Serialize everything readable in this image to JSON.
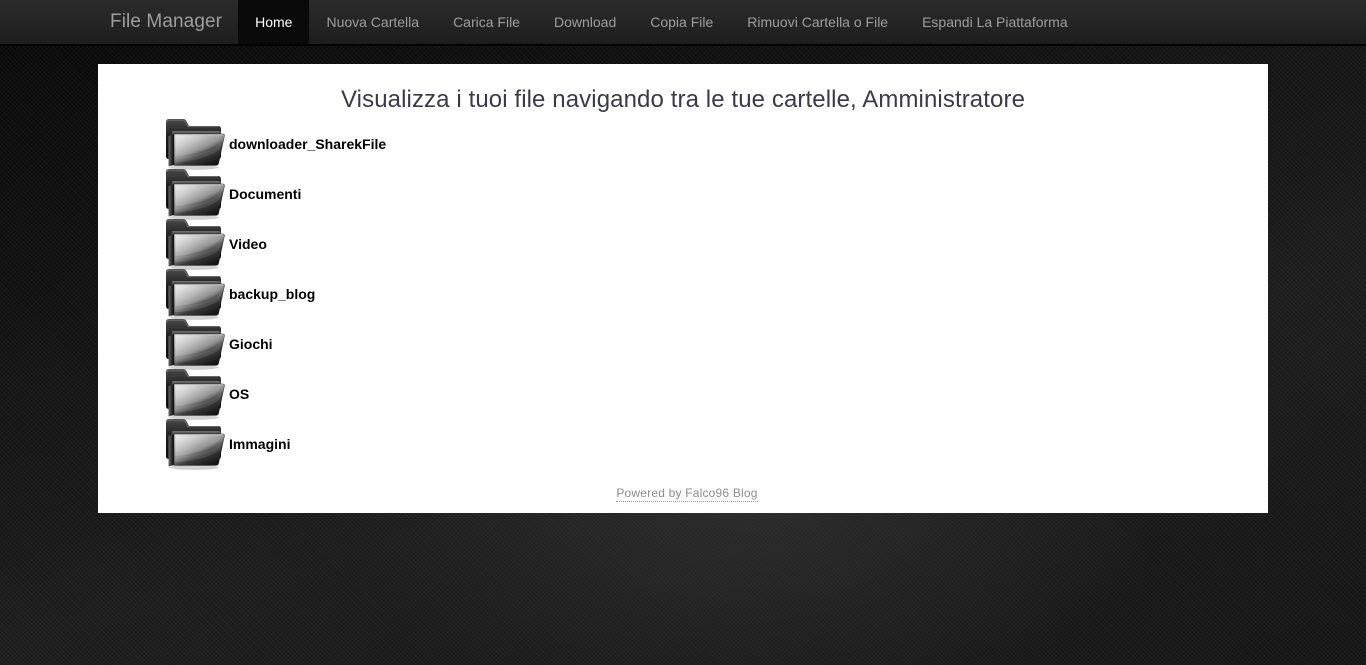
{
  "navbar": {
    "brand": "File Manager",
    "items": [
      {
        "label": "Home",
        "active": true
      },
      {
        "label": "Nuova Cartella",
        "active": false
      },
      {
        "label": "Carica File",
        "active": false
      },
      {
        "label": "Download",
        "active": false
      },
      {
        "label": "Copia File",
        "active": false
      },
      {
        "label": "Rimuovi Cartella o File",
        "active": false
      },
      {
        "label": "Espandi La Piattaforma",
        "active": false
      }
    ],
    "background_color": "#242424",
    "active_background_color": "#0a0a0a",
    "text_color": "#9d9d9d"
  },
  "main": {
    "page_title": "Visualizza i tuoi file navigando tra le tue cartelle, Amministratore",
    "title_color": "#3b3b47",
    "panel_background": "#ffffff",
    "folders": [
      {
        "name": "downloader_SharekFile",
        "icon": "folder-icon"
      },
      {
        "name": "Documenti",
        "icon": "folder-icon"
      },
      {
        "name": "Video",
        "icon": "folder-icon"
      },
      {
        "name": "backup_blog",
        "icon": "folder-icon"
      },
      {
        "name": "Giochi",
        "icon": "folder-icon"
      },
      {
        "name": "OS",
        "icon": "folder-icon"
      },
      {
        "name": "Immagini",
        "icon": "folder-icon"
      }
    ]
  },
  "footer": {
    "credit": "Powered by Falco96 Blog",
    "credit_color": "#8d8d8d"
  },
  "page": {
    "background_color": "#0d0d0d"
  }
}
